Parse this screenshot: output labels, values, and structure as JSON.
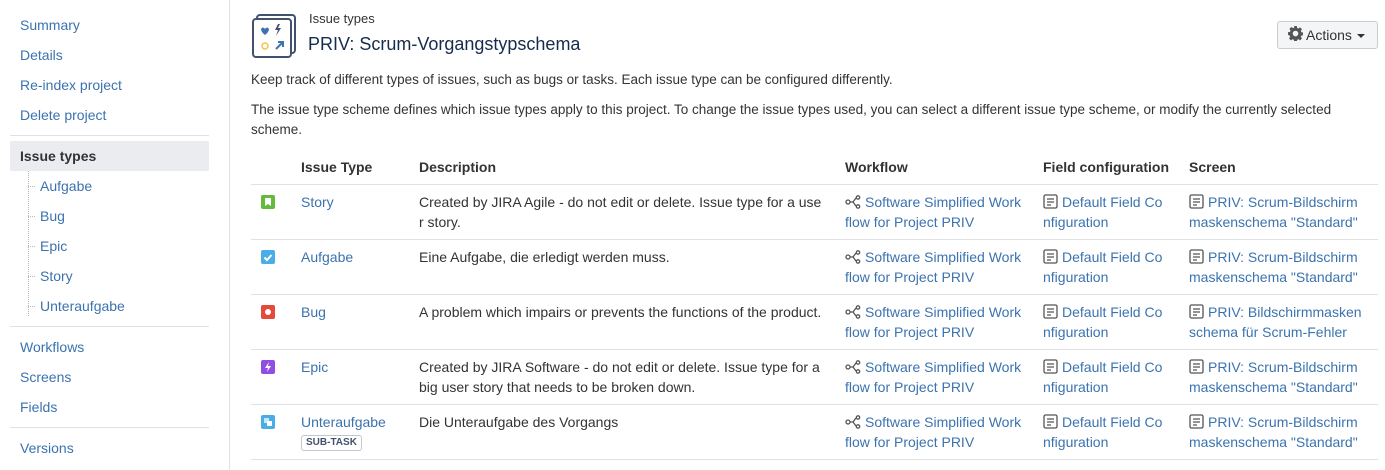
{
  "sidebar": {
    "items_top": [
      "Summary",
      "Details",
      "Re-index project",
      "Delete project"
    ],
    "selected": "Issue types",
    "sub_items": [
      "Aufgabe",
      "Bug",
      "Epic",
      "Story",
      "Unteraufgabe"
    ],
    "items_mid": [
      "Workflows",
      "Screens",
      "Fields"
    ],
    "items_bottom": [
      "Versions"
    ]
  },
  "header": {
    "breadcrumb": "Issue types",
    "title": "PRIV: Scrum-Vorgangstypschema",
    "actions_label": "Actions"
  },
  "intro": {
    "line1": "Keep track of different types of issues, such as bugs or tasks. Each issue type can be configured differently.",
    "line2a": "The issue type scheme defines which issue types apply to this project. To change the issue types used, you can select a different issue type scheme, or modify the currently selected",
    "line2b": "scheme."
  },
  "table": {
    "headers": {
      "issue_type": "Issue Type",
      "description": "Description",
      "workflow": "Workflow",
      "field_configuration": "Field configuration",
      "screen": "Screen"
    },
    "rows": [
      {
        "icon": "story-icon",
        "color": "#63ba3c",
        "name": "Story",
        "desc1": "Created by JIRA Agile - do not edit or delete. Issue type for a use",
        "desc2": "r story.",
        "wf1": "Software Simplified Work",
        "wf2": "flow for Project PRIV",
        "fc1": "Default Field Co",
        "fc2": "nfiguration",
        "sc1": "PRIV: Scrum-Bildschirm",
        "sc2": "maskenschema \"Standard\""
      },
      {
        "icon": "task-icon",
        "color": "#4bade8",
        "name": "Aufgabe",
        "desc1": "Eine Aufgabe, die erledigt werden muss.",
        "desc2": "",
        "wf1": "Software Simplified Work",
        "wf2": "flow for Project PRIV",
        "fc1": "Default Field Co",
        "fc2": "nfiguration",
        "sc1": "PRIV: Scrum-Bildschirm",
        "sc2": "maskenschema \"Standard\""
      },
      {
        "icon": "bug-icon",
        "color": "#e5493a",
        "name": "Bug",
        "desc1": "A problem which impairs or prevents the functions of the product.",
        "desc2": "",
        "wf1": "Software Simplified Work",
        "wf2": "flow for Project PRIV",
        "fc1": "Default Field Co",
        "fc2": "nfiguration",
        "sc1": "PRIV: Bildschirmmasken",
        "sc2": "schema für Scrum-Fehler"
      },
      {
        "icon": "epic-icon",
        "color": "#904ee2",
        "name": "Epic",
        "desc1": "Created by JIRA Software - do not edit or delete. Issue type for a",
        "desc2": "big user story that needs to be broken down.",
        "wf1": "Software Simplified Work",
        "wf2": "flow for Project PRIV",
        "fc1": "Default Field Co",
        "fc2": "nfiguration",
        "sc1": "PRIV: Scrum-Bildschirm",
        "sc2": "maskenschema \"Standard\""
      },
      {
        "icon": "subtask-icon",
        "color": "#4bade8",
        "name": "Unteraufgabe",
        "lozenge": "SUB-TASK",
        "desc1": "Die Unteraufgabe des Vorgangs",
        "desc2": "",
        "wf1": "Software Simplified Work",
        "wf2": "flow for Project PRIV",
        "fc1": "Default Field Co",
        "fc2": "nfiguration",
        "sc1": "PRIV: Scrum-Bildschirm",
        "sc2": "maskenschema \"Standard\""
      }
    ]
  }
}
